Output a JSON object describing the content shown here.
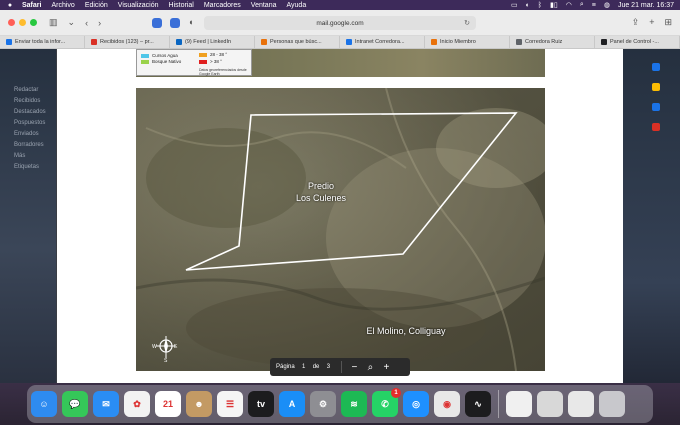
{
  "menubar": {
    "app": "Safari",
    "items": [
      "Archivo",
      "Edición",
      "Visualización",
      "Historial",
      "Marcadores",
      "Ventana",
      "Ayuda"
    ],
    "datetime": "Jue 21 mar.  16:37"
  },
  "toolbar": {
    "url": "mail.google.com"
  },
  "tabs": [
    {
      "label": "Enviar toda la infor...",
      "color": "#1a73e8"
    },
    {
      "label": "Recibidos (123) – pr...",
      "color": "#d93025"
    },
    {
      "label": "(9) Feed | LinkedIn",
      "color": "#0a66c2"
    },
    {
      "label": "Personas que búsc...",
      "color": "#e8710a"
    },
    {
      "label": "Intranet Corredora...",
      "color": "#1a73e8"
    },
    {
      "label": "Inicio Miembro",
      "color": "#e8710a"
    },
    {
      "label": "Corredora Ruiz",
      "color": "#5f6368"
    },
    {
      "label": "Panel de Control -...",
      "color": "#202124"
    }
  ],
  "gmail_bg": {
    "sidebar_items": [
      "Redactar",
      "Recibidos",
      "Destacados",
      "Pospuestos",
      "Enviados",
      "Borradores",
      "Más",
      "Etiquetas"
    ]
  },
  "legend": {
    "items": [
      {
        "label": "Cursos Agua",
        "color": "#4fc6e8"
      },
      {
        "label": "Bosque Nativo",
        "color": "#9ad24a"
      }
    ],
    "slopes": [
      {
        "label": "28 - 38 °",
        "color": "#f0a020"
      },
      {
        "label": "> 38 °",
        "color": "#e02020"
      }
    ],
    "note": "Datos georeferenciados desde Google Earth"
  },
  "map": {
    "labels": {
      "predio": "Predio\nLos Culenes",
      "molino": "El Molino, Colliguay"
    },
    "compass": {
      "w": "W",
      "e": "E",
      "s": "S"
    }
  },
  "pdf_controls": {
    "page_label": "Página",
    "current_page": "1",
    "of_label": "de",
    "total_pages": "3",
    "zoom_out": "−",
    "zoom_in": "+"
  },
  "dock": {
    "apps": [
      {
        "name": "Finder",
        "color": "#2e8bf0",
        "glyph": "☺"
      },
      {
        "name": "Messages",
        "color": "#35c759",
        "glyph": "💬"
      },
      {
        "name": "Mail",
        "color": "#2a8df4",
        "glyph": "✉"
      },
      {
        "name": "Photos",
        "color": "#f2f2f2",
        "glyph": "✿"
      },
      {
        "name": "Calendar",
        "color": "#ffffff",
        "glyph": "21"
      },
      {
        "name": "Contacts",
        "color": "#c39a64",
        "glyph": "☻"
      },
      {
        "name": "Reminders",
        "color": "#f5f5f5",
        "glyph": "☰"
      },
      {
        "name": "TV",
        "color": "#1c1c1e",
        "glyph": "tv"
      },
      {
        "name": "App Store",
        "color": "#1a8ef7",
        "glyph": "A"
      },
      {
        "name": "System Settings",
        "color": "#8e8e93",
        "glyph": "⚙"
      },
      {
        "name": "Spotify",
        "color": "#1db954",
        "glyph": "≋"
      },
      {
        "name": "WhatsApp",
        "color": "#25d366",
        "glyph": "✆",
        "badge": "1"
      },
      {
        "name": "Safari",
        "color": "#1e90ff",
        "glyph": "◎"
      },
      {
        "name": "Chrome",
        "color": "#e8e8e8",
        "glyph": "◉"
      },
      {
        "name": "Voice Memos",
        "color": "#1c1c1e",
        "glyph": "∿"
      }
    ],
    "recent": [
      {
        "name": "Recent document",
        "color": "#f0f0f0"
      },
      {
        "name": "Recent window",
        "color": "#d8d8d8"
      },
      {
        "name": "WhatsApp window",
        "color": "#e8e8e8"
      },
      {
        "name": "Trash",
        "color": "#c8c8cc"
      }
    ]
  }
}
